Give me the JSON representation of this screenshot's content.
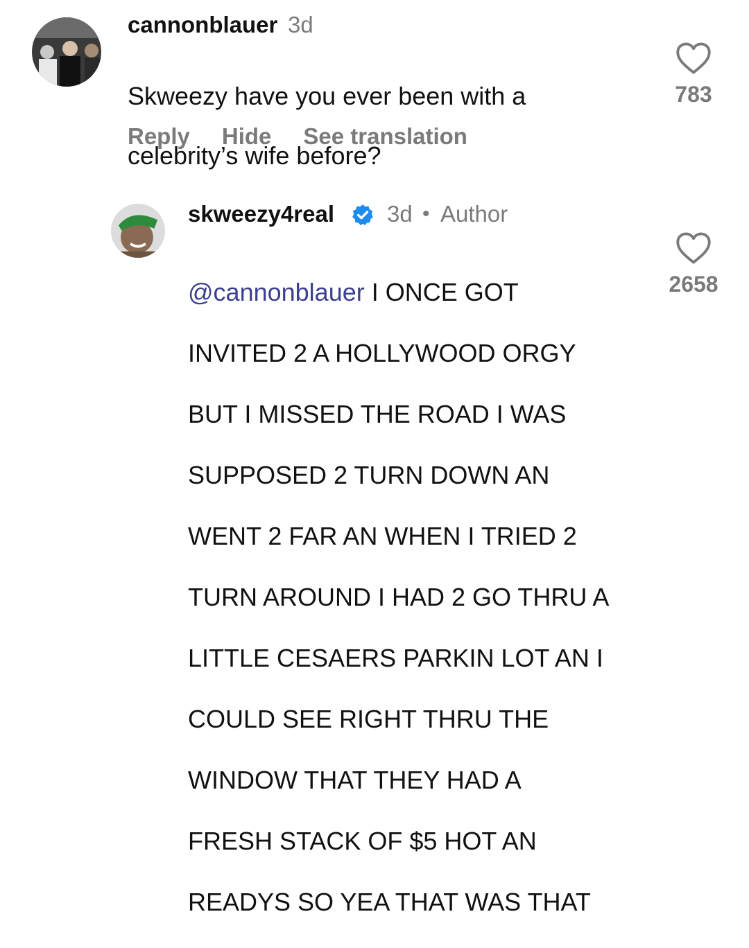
{
  "comments": [
    {
      "username": "cannonblauer",
      "time": "3d",
      "text_lines": [
        "Skweezy have you ever been with a",
        "celebrity’s wife before?"
      ],
      "actions": {
        "reply": "Reply",
        "hide": "Hide",
        "translate": "See translation"
      },
      "likes": "783",
      "avatar_icon": "profile-photo"
    },
    {
      "username": "skweezy4real",
      "verified": true,
      "time": "3d",
      "separator": "•",
      "author_label": "Author",
      "mention": "@cannonblauer",
      "text_lines": [
        " I ONCE GOT",
        "INVITED 2 A HOLLYWOOD ORGY",
        "BUT I MISSED THE ROAD I WAS",
        "SUPPOSED 2 TURN DOWN AN",
        "WENT 2 FAR AN WHEN I TRIED 2",
        "TURN AROUND I HAD 2 GO THRU A",
        "LITTLE CESAERS PARKIN LOT AN I",
        "COULD SEE RIGHT THRU THE",
        "WINDOW THAT THEY HAD A",
        "FRESH STACK OF $5 HOT AN",
        "READYS SO YEA THAT WAS THAT"
      ],
      "likes": "2658",
      "avatar_icon": "profile-photo"
    }
  ],
  "colors": {
    "text": "#111111",
    "secondary": "#7a7a7a",
    "mention": "#3b3f8f",
    "verified": "#1d8cf0"
  },
  "icons": [
    "heart-icon",
    "verified-badge-icon"
  ]
}
